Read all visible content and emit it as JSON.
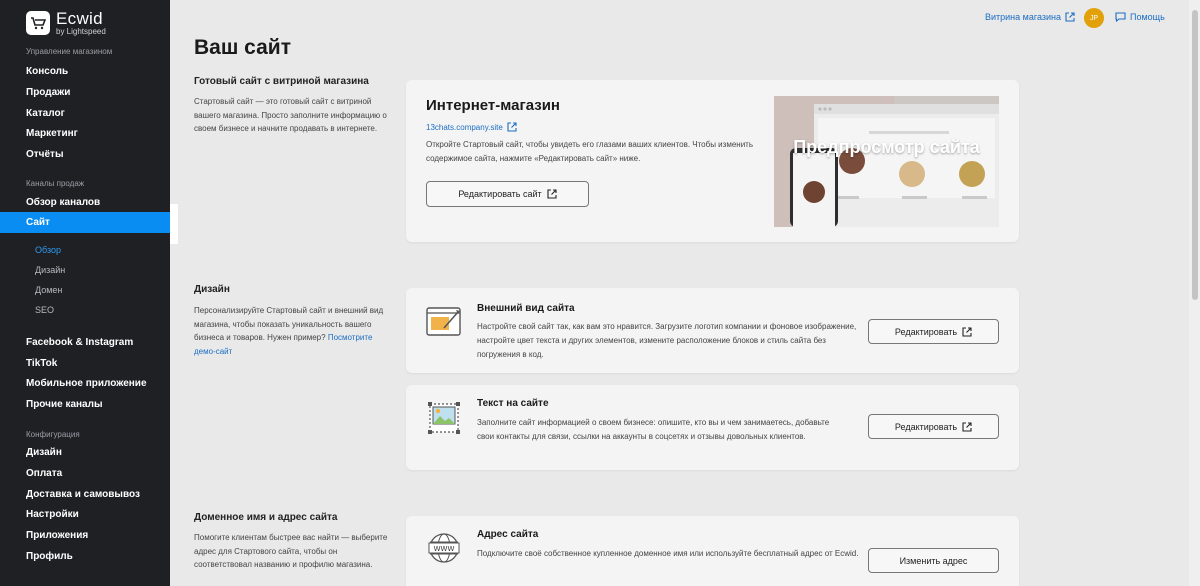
{
  "sidebar": {
    "logo": {
      "name": "Ecwid",
      "sub": "by Lightspeed"
    },
    "sections": {
      "manage": "Управление магазином",
      "channels": "Каналы продаж",
      "config": "Конфигурация"
    },
    "manage_items": [
      "Консоль",
      "Продажи",
      "Каталог",
      "Маркетинг",
      "Отчёты"
    ],
    "channels_items": [
      "Обзор каналов",
      "Сайт"
    ],
    "site_sub": [
      "Обзор",
      "Дизайн",
      "Домен",
      "SEO"
    ],
    "other_channels": [
      "Facebook & Instagram",
      "TikTok",
      "Мобильное приложение",
      "Прочие каналы"
    ],
    "config_items": [
      "Дизайн",
      "Оплата",
      "Доставка и самовывоз",
      "Настройки",
      "Приложения",
      "Профиль"
    ]
  },
  "topbar": {
    "storefront": "Витрина магазина",
    "avatar": "JP",
    "help": "Помощь"
  },
  "page_title": "Ваш сайт",
  "ready": {
    "heading": "Готовый сайт с витриной магазина",
    "text": "Стартовый сайт — это готовый сайт с витриной вашего магазина. Просто заполните информацию о своем бизнесе и начните продавать в интернете.",
    "card_title": "Интернет-магазин",
    "site_url": "13chats.company.site",
    "card_text": "Откройте Стартовый сайт, чтобы увидеть его глазами ваших клиентов. Чтобы изменить содержимое сайта, нажмите «Редактировать сайт» ниже.",
    "edit_button": "Редактировать сайт",
    "preview_label": "Предпросмотр сайта"
  },
  "design": {
    "heading": "Дизайн",
    "text": "Персонализируйте Стартовый сайт и внешний вид магазина, чтобы показать уникальность вашего бизнеса и товаров. Нужен пример?",
    "demo_link": "Посмотрите демо-сайт",
    "look": {
      "title": "Внешний вид сайта",
      "text": "Настройте свой сайт так, как вам это нравится. Загрузите логотип компании и фоновое изображение, настройте цвет текста и других элементов, измените расположение блоков и стиль сайта без погружения в код.",
      "button": "Редактировать"
    },
    "content": {
      "title": "Текст на сайте",
      "text": "Заполните сайт информацией о своем бизнесе: опишите, кто вы и чем занимаетесь, добавьте свои контакты для связи, ссылки на аккаунты в соцсетях и отзывы довольных клиентов.",
      "button": "Редактировать"
    }
  },
  "domain": {
    "heading": "Доменное имя и адрес сайта",
    "text": "Помогите клиентам быстрее вас найти — выберите адрес для Стартового сайта, чтобы он соответствовал названию и профилю магазина.",
    "card_title": "Адрес сайта",
    "card_text": "Подключите своё собственное купленное доменное имя или используйте бесплатный адрес от Ecwid.",
    "button": "Изменить адрес",
    "www": "WWW"
  },
  "colors": {
    "accent": "#0a8df2",
    "sidebar": "#1e2024",
    "link": "#1b6ec2",
    "avatar": "#e2a00a"
  }
}
